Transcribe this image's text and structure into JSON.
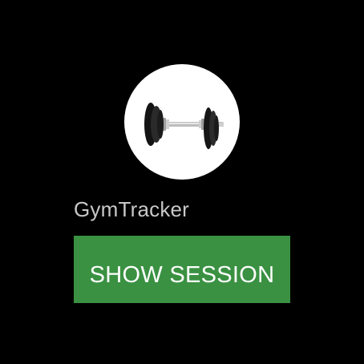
{
  "app": {
    "name": "GymTracker",
    "icon": "dumbbell-icon",
    "icon_background": "#ffffff"
  },
  "action": {
    "label": "SHOW SESSION",
    "color": "#3a9142"
  },
  "colors": {
    "background": "#000000",
    "app_name_text": "#c8c8c8",
    "button_text": "#ffffff"
  }
}
